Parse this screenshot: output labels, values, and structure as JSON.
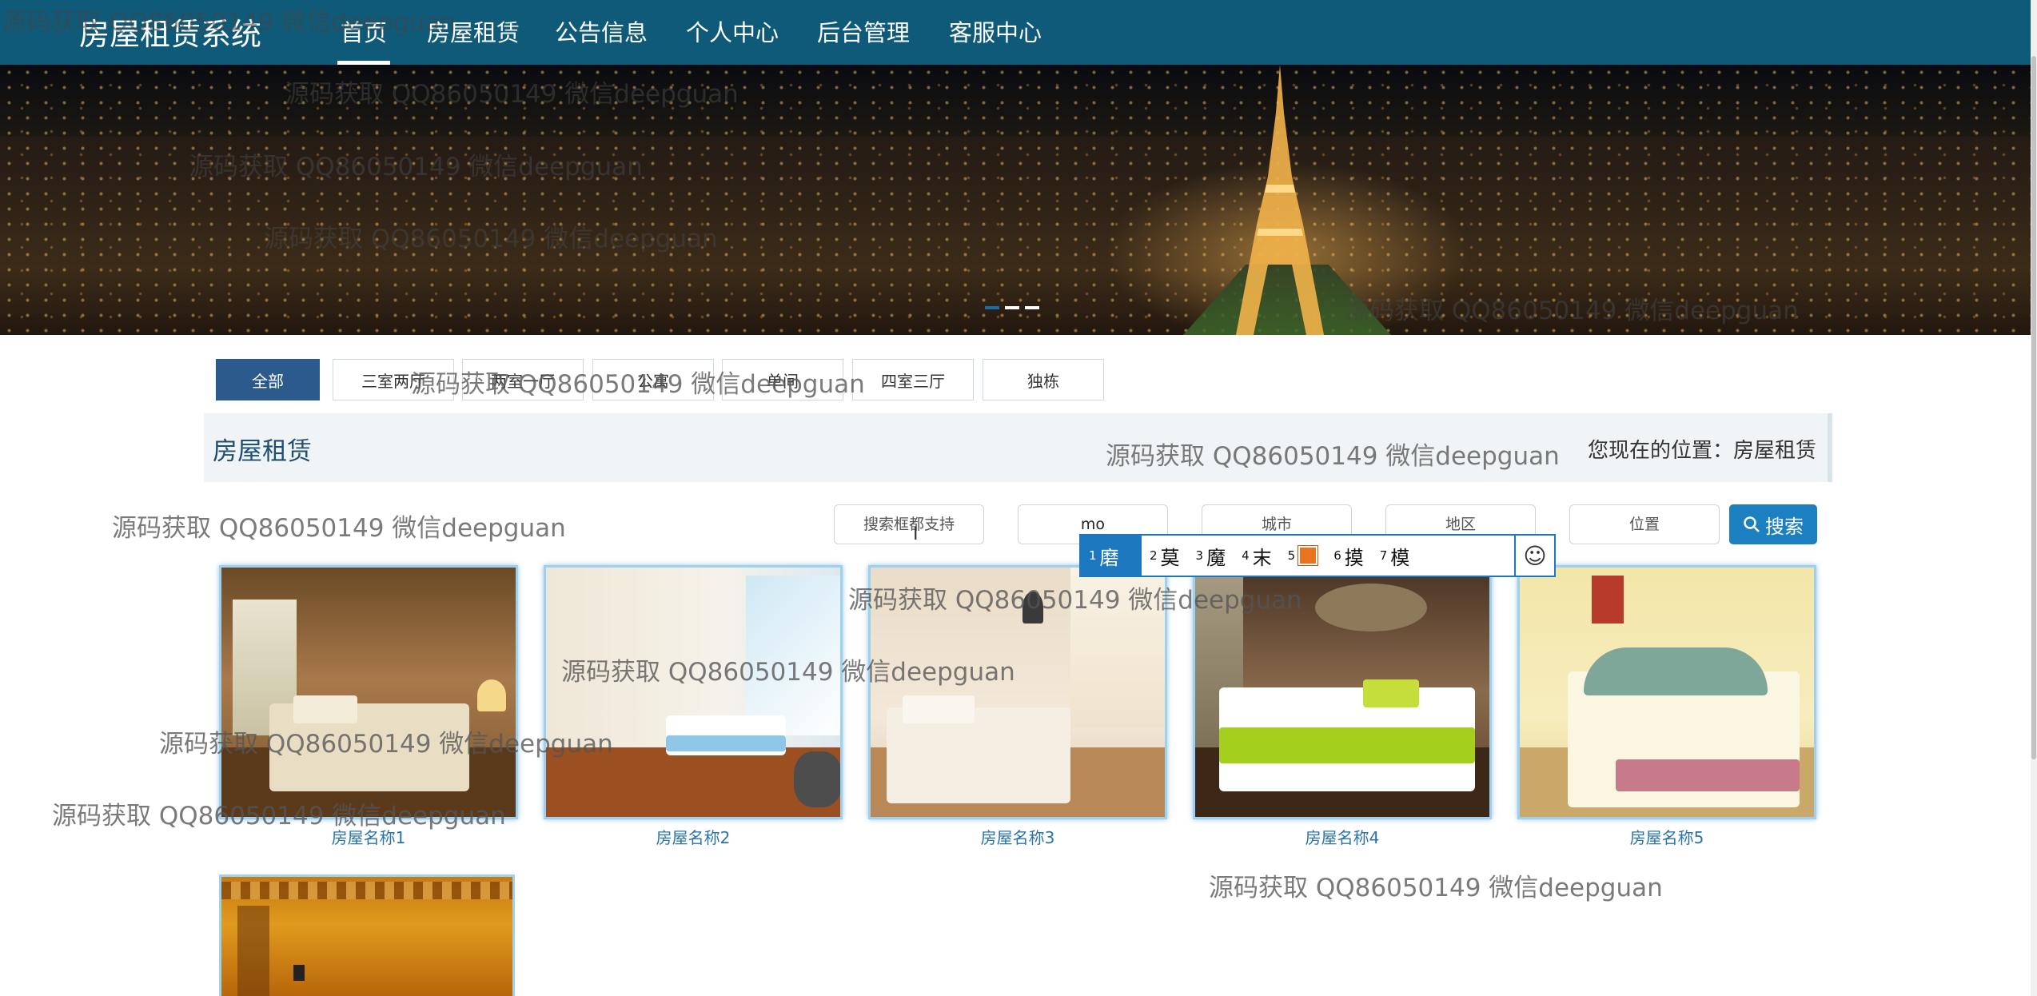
{
  "brand": "房屋租赁系统",
  "nav": [
    {
      "label": "首页",
      "active": true
    },
    {
      "label": "房屋租赁",
      "active": false
    },
    {
      "label": "公告信息",
      "active": false
    },
    {
      "label": "个人中心",
      "active": false
    },
    {
      "label": "后台管理",
      "active": false
    },
    {
      "label": "客服中心",
      "active": false
    }
  ],
  "banner": {
    "slides": 3,
    "active_slide": 1
  },
  "categories": [
    "全部",
    "三室两厅",
    "两室一厅",
    "公寓",
    "单间",
    "四室三厅",
    "独栋"
  ],
  "active_category": "全部",
  "section": {
    "title": "房屋租赁",
    "location_label": "您现在的位置：",
    "location_value": "房屋租赁"
  },
  "search": {
    "field1_placeholder": "搜索框都支持",
    "field2_value": "mo",
    "field3_placeholder": "城市",
    "field4_placeholder": "地区",
    "field5_placeholder": "位置",
    "button_label": "搜索",
    "button_icon": "search-icon"
  },
  "ime": {
    "candidates": [
      {
        "num": "1",
        "char": "磨"
      },
      {
        "num": "2",
        "char": "莫"
      },
      {
        "num": "3",
        "char": "魔"
      },
      {
        "num": "4",
        "char": "末"
      },
      {
        "num": "5",
        "char": ""
      },
      {
        "num": "6",
        "char": "摸"
      },
      {
        "num": "7",
        "char": "模"
      }
    ],
    "selected_index": 0,
    "emoji_icon": "smiley-icon"
  },
  "houses": [
    {
      "name": "房屋名称1"
    },
    {
      "name": "房屋名称2"
    },
    {
      "name": "房屋名称3"
    },
    {
      "name": "房屋名称4"
    },
    {
      "name": "房屋名称5"
    }
  ],
  "watermark": "源码获取 QQ86050149 微信deepguan"
}
